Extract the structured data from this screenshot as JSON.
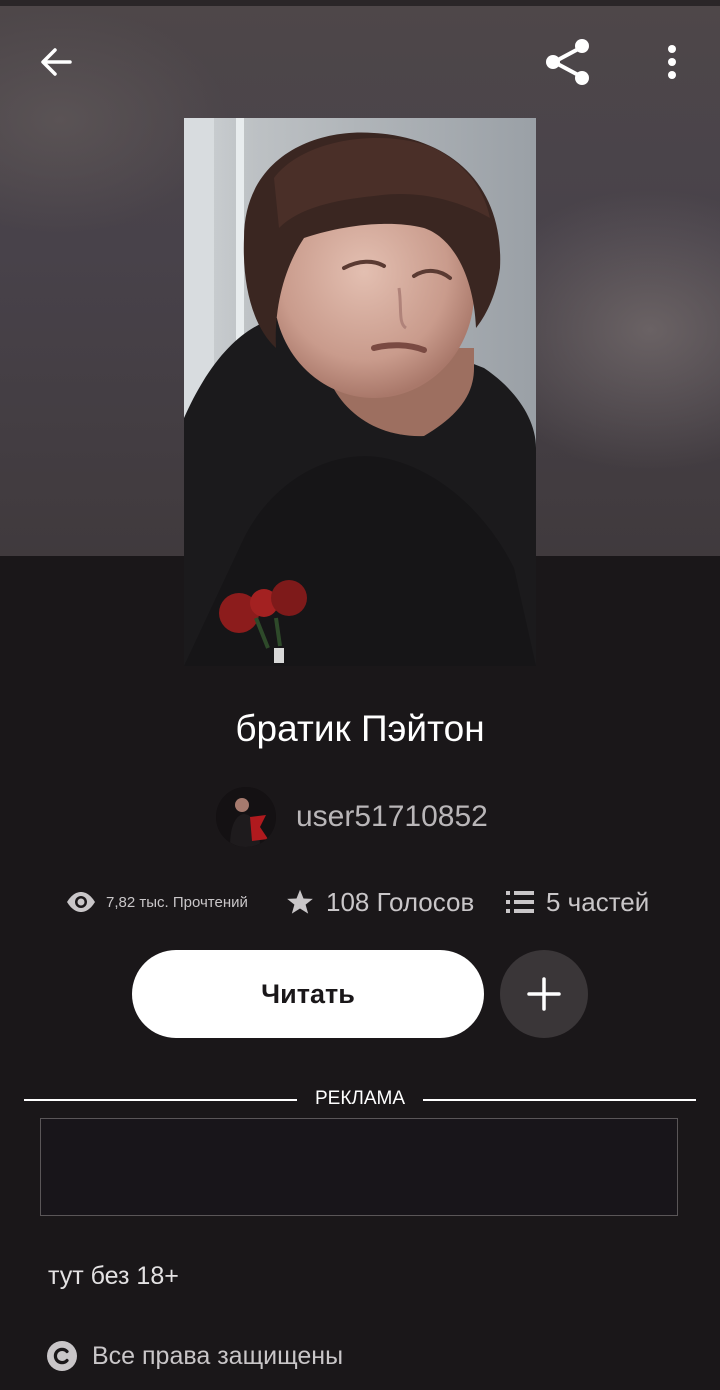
{
  "story": {
    "title": "братик Пэйтон",
    "author": "user51710852",
    "description": "тут без 18+",
    "copyright": "Все права защищены"
  },
  "stats": {
    "reads": "7,82 тыс. Прочтений",
    "votes": "108 Голосов",
    "parts": "5 частей"
  },
  "actions": {
    "read_label": "Читать"
  },
  "ad": {
    "label": "РЕКЛАМА"
  },
  "icons": {
    "back": "arrow-left-icon",
    "share": "share-icon",
    "more": "more-vertical-icon",
    "reads": "eye-icon",
    "votes": "star-icon",
    "parts": "list-icon",
    "add": "plus-icon",
    "copyright": "copyright-icon"
  },
  "colors": {
    "background": "#1a1719",
    "read_button": "#ffffff",
    "add_button": "#3a3638"
  }
}
